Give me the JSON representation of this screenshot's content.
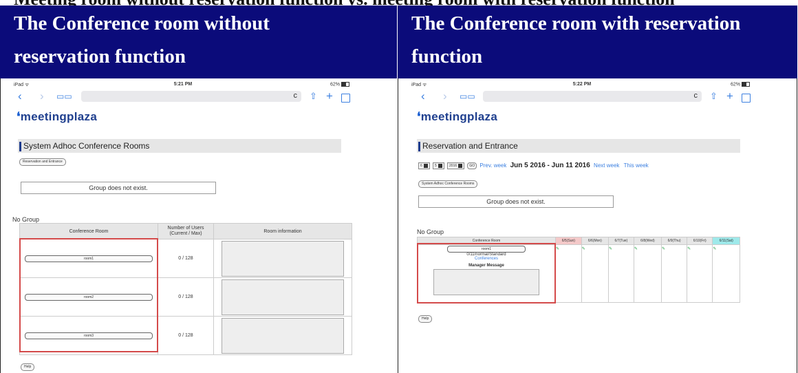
{
  "caption_partial": "Meeting room without reservation function vs. meeting room with reservation function",
  "headers": {
    "left": [
      "The Conference room without",
      "reservation function"
    ],
    "right": [
      "The Conference room with reservation",
      "function"
    ]
  },
  "left": {
    "status": {
      "device": "iPad ᯤ",
      "time": "5:21 PM",
      "battery": "62%"
    },
    "nav": {
      "back": "‹",
      "forward": "›",
      "bookmarks": "📖",
      "reload": "c",
      "share": "⇧",
      "add": "+",
      "tabs_icon": "tabs-icon"
    },
    "logo": "meetingplaza",
    "section_title": "System Adhoc Conference Rooms",
    "switch_button": "Reservation and Entrance",
    "message": "Group does not exist.",
    "group_label": "No Group",
    "table": {
      "headers": [
        "Conference Room",
        "Number of Users\n(Current / Max)",
        "Room information"
      ],
      "rows": [
        {
          "room": "room1",
          "users": "0 / 128"
        },
        {
          "room": "room2",
          "users": "0 / 128"
        },
        {
          "room": "room3",
          "users": "0 / 128"
        }
      ]
    },
    "help_button": "Help"
  },
  "right": {
    "status": {
      "device": "iPad ᯤ",
      "time": "5:22 PM",
      "battery": "62%"
    },
    "nav": {
      "back": "‹",
      "forward": "›",
      "bookmarks": "📖",
      "reload": "c",
      "share": "⇧",
      "add": "+",
      "tabs_icon": "tabs-icon"
    },
    "logo": "meetingplaza",
    "section_title": "Reservation and Entrance",
    "selects": [
      "6",
      "5",
      "2016"
    ],
    "go_button": "GO",
    "prev_week": "Prev. week",
    "week_range": "Jun 5 2016 - Jun 11 2016",
    "next_week": "Next week",
    "this_week": "This week",
    "switch_button": "System Adhoc Conference Rooms",
    "message": "Group does not exist.",
    "group_label": "No Group",
    "calendar": {
      "room_header": "Conference Room",
      "days": [
        "6/5(Sun)",
        "6/6(Mon)",
        "6/7(Tue)",
        "6/8(Wed)",
        "6/9(Thu)",
        "6/10(Fri)",
        "6/11(Sat)"
      ],
      "room": "room1",
      "room_info": "0/11/normal/Standard",
      "conferences_link": "Conferences",
      "manager_message": "Manager Message"
    },
    "help_button": "Help"
  },
  "colors": {
    "header_bg": "#0b0b7a",
    "highlight": "#d44a4a",
    "link": "#3b7fe0",
    "sun": "#f4c9c9",
    "sat": "#9ee9ea"
  }
}
